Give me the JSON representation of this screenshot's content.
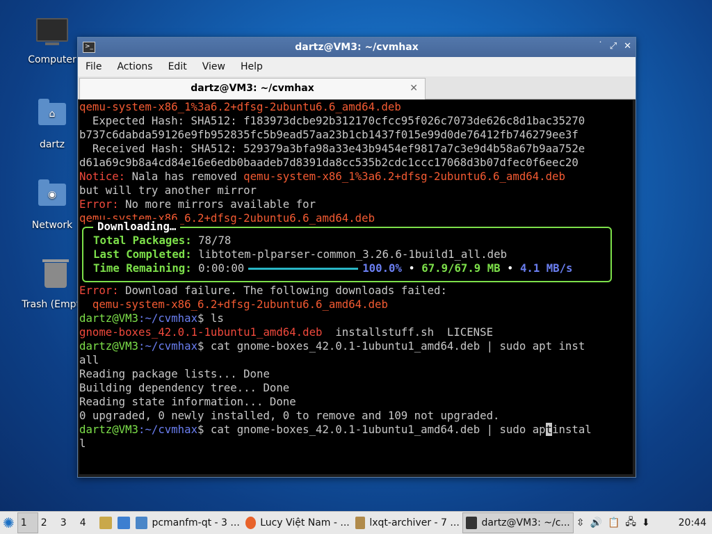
{
  "desktop": {
    "icons": [
      {
        "label": "Computer"
      },
      {
        "label": "dartz"
      },
      {
        "label": "Network"
      },
      {
        "label": "Trash (Empty)"
      }
    ]
  },
  "window": {
    "title": "dartz@VM3: ~/cvmhax",
    "controls": {
      "minimize": "˙",
      "maximize": "⤢",
      "close": "✕"
    },
    "menu": [
      "File",
      "Actions",
      "Edit",
      "View",
      "Help"
    ],
    "tab": {
      "label": "dartz@VM3: ~/cvmhax",
      "close": "✕"
    }
  },
  "terminal": {
    "l1": "qemu-system-x86_1%3a6.2+dfsg-2ubuntu6.6_amd64.deb",
    "l2": "  Expected Hash: SHA512: f183973dcbe92b312170cfcc95f026c7073de626c8d1bac35270",
    "l3": "b737c6dabda59126e9fb952835fc5b9ead57aa23b1cb1437f015e99d0de76412fb746279ee3f",
    "l4": "  Received Hash: SHA512: 529379a3bfa98a33e43b9454ef9817a7c3e9d4b58a67b9aa752e",
    "l5": "d61a69c9b8a4cd84e16e6edb0baadeb7d8391da8cc535b2cdc1ccc17068d3b07dfec0f6eec20",
    "l6_label": "Notice:",
    "l6_text": " Nala has removed ",
    "l6_pkg": "qemu-system-x86_1%3a6.2+dfsg-2ubuntu6.6_amd64.deb",
    "l7": "but will try another mirror",
    "l8_label": "Error:",
    "l8_text": " No more mirrors available for",
    "l9": "qemu-system-x86_6.2+dfsg-2ubuntu6.6_amd64.deb",
    "download": {
      "title": "Downloading…",
      "total_label": "Total Packages:",
      "total_value": " 78/78",
      "last_label": "Last Completed:",
      "last_value": " libtotem-plparser-common_3.26.6-1build1_all.deb",
      "time_label": "Time Remaining:",
      "time_value": " 0:00:00",
      "percent": "100.0%",
      "bullet1": " • ",
      "size": "67.9/67.9 MB",
      "bullet2": " • ",
      "speed": "4.1 MB/s",
      "progress": 1.0
    },
    "e1_label": "Error:",
    "e1_text": " Download failure. The following downloads failed:",
    "e2": "  qemu-system-x86_6.2+dfsg-2ubuntu6.6_amd64.deb",
    "prompt_user": "dartz@VM3",
    "prompt_path": ":~/cvmhax",
    "prompt_sym": "$ ",
    "cmd1": "ls",
    "ls_deb": "gnome-boxes_42.0.1-1ubuntu1_amd64.deb",
    "ls_rest": "  installstuff.sh  LICENSE",
    "cmd2": "cat gnome-boxes_42.0.1-1ubuntu1_amd64.deb | sudo apt inst",
    "cmd2b": "all",
    "o1": "Reading package lists... Done",
    "o2": "Building dependency tree... Done",
    "o3": "Reading state information... Done",
    "o4": "0 upgraded, 0 newly installed, 0 to remove and 109 not upgraded.",
    "cmd3a": "cat gnome-boxes_42.0.1-1ubuntu1_amd64.deb | sudo ap",
    "cmd3cur": "t",
    "cmd3b": "instal",
    "cmd3c": "l"
  },
  "taskbar": {
    "workspaces": [
      "1",
      "2",
      "3",
      "4"
    ],
    "tasks": [
      {
        "label": "pcmanfm-qt - 3 ..."
      },
      {
        "label": "Lucy Việt Nam - ..."
      },
      {
        "label": "lxqt-archiver - 7 ..."
      },
      {
        "label": "dartz@VM3: ~/c..."
      }
    ],
    "clock": "20:44"
  }
}
